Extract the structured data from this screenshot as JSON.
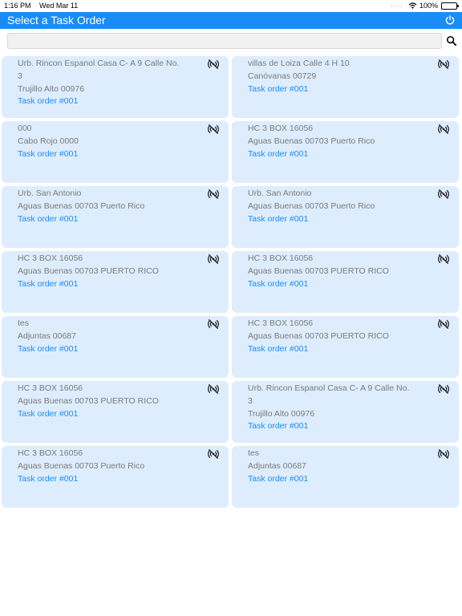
{
  "status_bar": {
    "time": "1:16 PM",
    "date": "Wed Mar 11",
    "battery": "100%",
    "battery_level": 1.0
  },
  "nav": {
    "title": "Select a Task Order",
    "power_icon": "power-icon"
  },
  "search": {
    "value": "",
    "placeholder": "",
    "icon": "search-icon"
  },
  "colors": {
    "nav_bg": "#1a8cf5",
    "card_bg": "#deedfd",
    "link": "#1a8cf5",
    "address_text": "#7a7a7a"
  },
  "cards": [
    {
      "lines": [
        "Urb. Rincon Espanol Casa C- A 9 Calle No.",
        "3",
        "Trujillo Alto 00976"
      ],
      "task": "Task order #001",
      "icon": "no-signal-icon"
    },
    {
      "lines": [
        "villas de Loiza Calle 4 H 10",
        "Canóvanas 00729"
      ],
      "task": "Task order #001",
      "icon": "no-signal-icon"
    },
    {
      "lines": [
        "000",
        "Cabo Rojo 0000"
      ],
      "task": "Task order #001",
      "icon": "no-signal-icon"
    },
    {
      "lines": [
        "HC 3 BOX 16056",
        "Aguas Buenas 00703 Puerto Rico"
      ],
      "task": "Task order #001",
      "icon": "no-signal-icon"
    },
    {
      "lines": [
        "Urb. San Antonio",
        "Aguas Buenas 00703 Puerto Rico"
      ],
      "task": "Task order #001",
      "icon": "no-signal-icon"
    },
    {
      "lines": [
        "Urb. San Antonio",
        "Aguas Buenas 00703 Puerto Rico"
      ],
      "task": "Task order #001",
      "icon": "no-signal-icon"
    },
    {
      "lines": [
        "HC 3 BOX 16056",
        "Aguas Buenas 00703 PUERTO RICO"
      ],
      "task": "Task order #001",
      "icon": "no-signal-icon"
    },
    {
      "lines": [
        "HC 3 BOX 16056",
        "Aguas Buenas 00703 PUERTO RICO"
      ],
      "task": "Task order #001",
      "icon": "no-signal-icon"
    },
    {
      "lines": [
        "tes",
        "Adjuntas 00687"
      ],
      "task": "Task order #001",
      "icon": "no-signal-icon"
    },
    {
      "lines": [
        "HC 3 BOX 16056",
        "Aguas Buenas 00703 PUERTO RICO"
      ],
      "task": "Task order #001",
      "icon": "no-signal-icon"
    },
    {
      "lines": [
        "HC 3 BOX 16056",
        "Aguas Buenas 00703 PUERTO RICO"
      ],
      "task": "Task order #001",
      "icon": "no-signal-icon"
    },
    {
      "lines": [
        "Urb. Rincon Espanol Casa C- A 9 Calle No.",
        "3",
        "Trujillo Alto 00976"
      ],
      "task": "Task order #001",
      "icon": "no-signal-icon"
    },
    {
      "lines": [
        "HC 3 BOX 16056",
        "Aguas Buenas 00703 Puerto Rico"
      ],
      "task": "Task order #001",
      "icon": "no-signal-icon"
    },
    {
      "lines": [
        "tes",
        "Adjuntas 00687"
      ],
      "task": "Task order #001",
      "icon": "no-signal-icon"
    }
  ]
}
